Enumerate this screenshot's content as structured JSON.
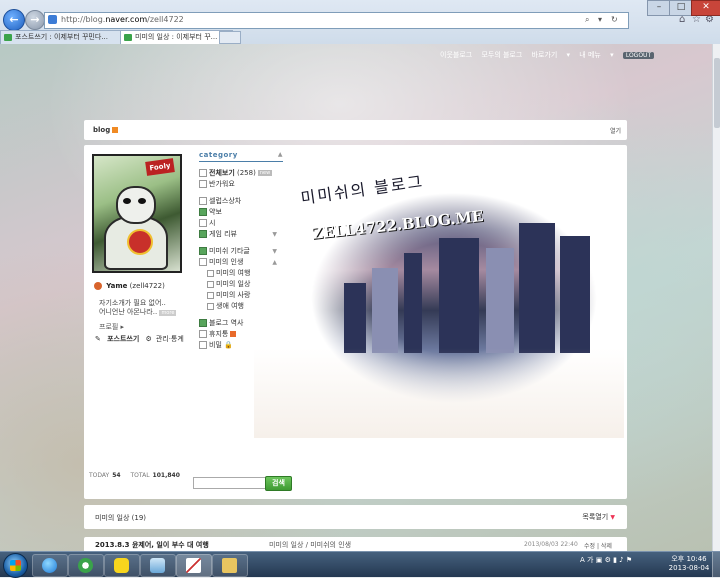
{
  "browser": {
    "url_prefix": "http://blog.",
    "url_domain": "naver.com",
    "url_path": "/zell4722",
    "tabs": [
      {
        "title": "포스트쓰기 : 이제부터 꾸민다..."
      },
      {
        "title": "미미의 일상 : 이제부터 꾸..."
      }
    ]
  },
  "toplinks": {
    "neighbor": "이웃블로그",
    "all": "모두의 블로그",
    "shortcut": "바로가기",
    "menu": "내 메뉴",
    "logout": "LOGOUT"
  },
  "blogbar": {
    "logo": "blog",
    "right": "열기"
  },
  "banner": {
    "title": "미미쉬의 블로그",
    "domain": "ZELL4722.BLOG.ME"
  },
  "profile": {
    "avatar_tag": "Fooly",
    "nickname": "Yame",
    "user_id": "(zell4722)",
    "intro_line1": "자기소개가 필요 없어..",
    "intro_line2": "어니언난 아몬나라..",
    "more": "more",
    "profile_link": "프로필",
    "write_post": "포스트쓰기",
    "manage": "관리·통계"
  },
  "category": {
    "title": "category",
    "all": "전체보기",
    "all_count": "(258)",
    "new_badge": "new",
    "items": [
      {
        "label": "반가워요"
      },
      {
        "label": "셀럽스상차"
      },
      {
        "label": "약보"
      },
      {
        "label": "시"
      },
      {
        "label": "게임 리뷰"
      },
      {
        "label": "미미쉬 기타글"
      },
      {
        "label": "미미의 인생"
      },
      {
        "label": "미미의 여행"
      },
      {
        "label": "미미의 일상"
      },
      {
        "label": "미미의 사랑"
      },
      {
        "label": "생애 여행"
      },
      {
        "label": "블로그 역사"
      },
      {
        "label": "휴지통"
      },
      {
        "label": "비밀"
      }
    ]
  },
  "stats": {
    "today_label": "TODAY",
    "today": "54",
    "total_label": "TOTAL",
    "total": "101,840"
  },
  "search": {
    "button": "검색",
    "placeholder": ""
  },
  "postlist": {
    "title": "미미의 일상 (19)",
    "toggle": "목록열기"
  },
  "post": {
    "title": "2013.8.3 윤제어, 일이 부수 대 여행",
    "category": "미미의 일상 / 미미쉬의 인생",
    "date": "2013/08/03 22:40",
    "edit": "수정",
    "delete": "삭제"
  },
  "taskbar": {
    "lang": "A",
    "clock_time": "오후 10:46",
    "clock_date": "2013-08-04"
  }
}
